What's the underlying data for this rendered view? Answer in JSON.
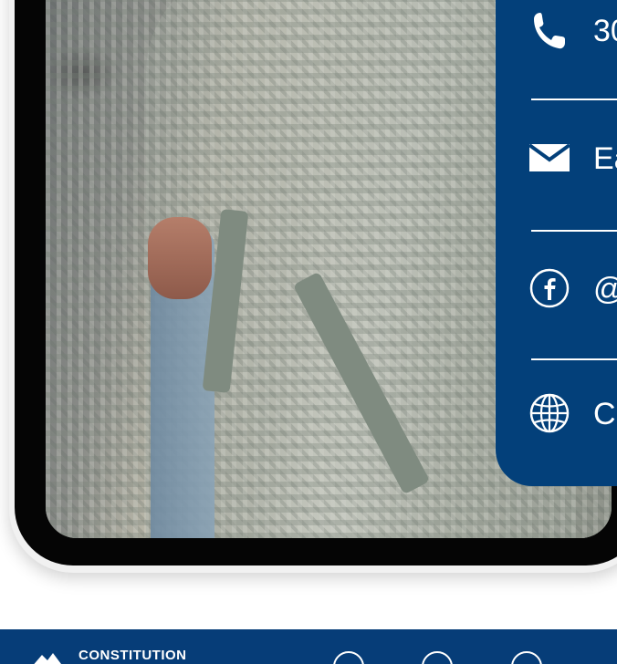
{
  "contact": {
    "phone_text": "30",
    "email_text": "Ea",
    "facebook_text": "@",
    "website_text": "C"
  },
  "footer": {
    "brand_text": "CONSTITUTION",
    "background_color": "#063d78"
  },
  "colors": {
    "card_blue": "#03407a",
    "frame_black": "#050505",
    "text_white": "#ffffff"
  },
  "icons": [
    "phone-icon",
    "mail-icon",
    "facebook-icon",
    "globe-icon"
  ]
}
